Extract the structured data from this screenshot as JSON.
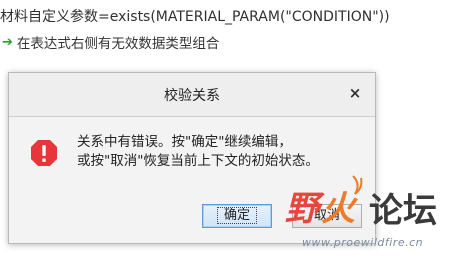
{
  "editor": {
    "code_line": "材料自定义参数=exists(MATERIAL_PARAM(\"CONDITION\"))",
    "hint_line": "在表达式右侧有无效数据类型组合",
    "hint_icon": "green-arrow-icon"
  },
  "dialog": {
    "title": "校验关系",
    "close_label": "×",
    "icon": "error-icon",
    "message_line1": "关系中有错误。按\"确定\"继续编辑，",
    "message_line2": "或按\"取消\"恢复当前上下文的初始状态。",
    "ok_label": "确定",
    "cancel_label": "取消"
  },
  "watermark": {
    "logo": "野火论坛",
    "url": "www.proewildfire.cn"
  },
  "colors": {
    "error_red": "#e8353b",
    "accent_blue": "#5e9bd6",
    "hint_green": "#2e9b2e"
  }
}
